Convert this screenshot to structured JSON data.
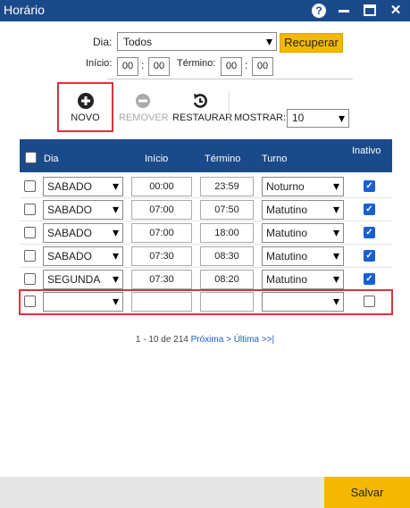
{
  "window": {
    "title": "Horário"
  },
  "filters": {
    "dia_label": "Dia:",
    "dia_value": "Todos",
    "recuperar_label": "Recuperar",
    "inicio_label": "Início:",
    "termino_label": "Término:",
    "inicio_h": "00",
    "inicio_m": "00",
    "termino_h": "00",
    "termino_m": "00",
    "colon": ":"
  },
  "toolbar": {
    "novo": "NOVO",
    "remover": "REMOVER",
    "restaurar": "RESTAURAR",
    "mostrar_label": "MOSTRAR:",
    "mostrar_value": "10"
  },
  "table": {
    "headers": {
      "dia": "Dia",
      "inicio": "Início",
      "termino": "Término",
      "turno": "Turno",
      "inativo": "Inativo"
    },
    "rows": [
      {
        "dia": "SABADO",
        "inicio": "00:00",
        "termino": "23:59",
        "turno": "Noturno",
        "inativo": true
      },
      {
        "dia": "SABADO",
        "inicio": "07:00",
        "termino": "07:50",
        "turno": "Matutino",
        "inativo": true
      },
      {
        "dia": "SABADO",
        "inicio": "07:00",
        "termino": "18:00",
        "turno": "Matutino",
        "inativo": true
      },
      {
        "dia": "SABADO",
        "inicio": "07:30",
        "termino": "08:30",
        "turno": "Matutino",
        "inativo": true
      },
      {
        "dia": "SEGUNDA",
        "inicio": "07:30",
        "termino": "08:20",
        "turno": "Matutino",
        "inativo": true
      }
    ],
    "new_row": {
      "dia": "",
      "inicio": "",
      "termino": "",
      "turno": "",
      "inativo": false
    }
  },
  "pager": {
    "range": "1 - 10 de 214",
    "next": "Próxima >",
    "last": "Última >>|"
  },
  "footer": {
    "salvar": "Salvar"
  },
  "icons": {
    "novo": "plus-circle-icon",
    "remover": "minus-circle-icon",
    "restaurar": "undo-icon"
  },
  "colors": {
    "header": "#1b4a8b",
    "accent": "#f5b800",
    "highlight": "#d9333a",
    "link": "#1b5fbf"
  }
}
